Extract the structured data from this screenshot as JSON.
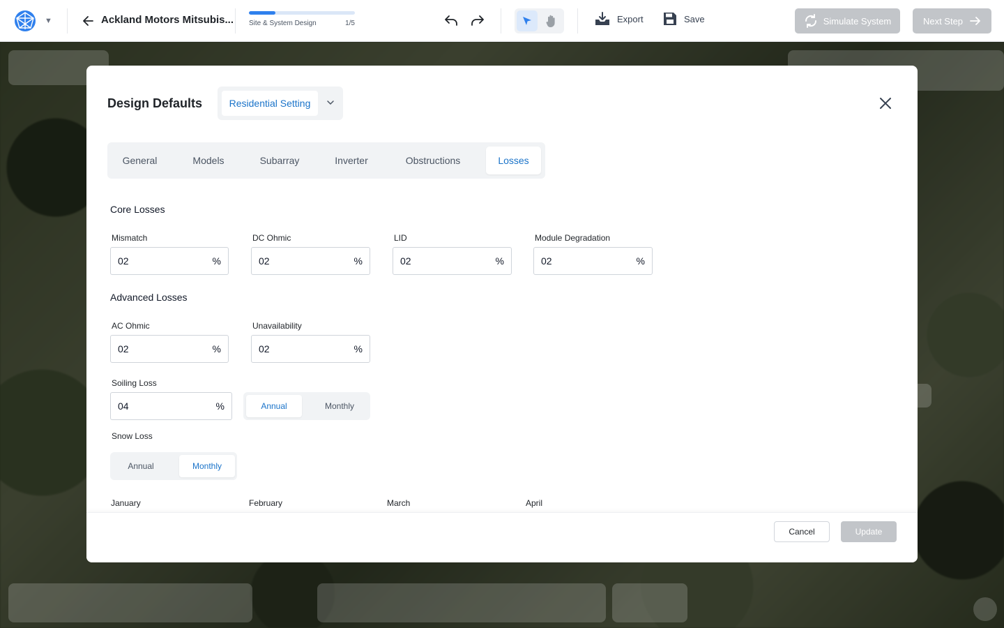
{
  "topbar": {
    "project_title": "Ackland Motors Mitsubis...",
    "progress": {
      "label": "Site & System Design",
      "step": "1/5",
      "fraction": 0.25
    },
    "export_label": "Export",
    "save_label": "Save",
    "simulate_label": "Simulate System",
    "next_label": "Next Step"
  },
  "modal": {
    "title": "Design Defaults",
    "setting": "Residential Setting",
    "tabs": [
      "General",
      "Models",
      "Subarray",
      "Inverter",
      "Obstructions",
      "Losses"
    ],
    "active_tab": "Losses",
    "core": {
      "title": "Core Losses",
      "fields": [
        {
          "label": "Mismatch",
          "value": "02",
          "unit": "%"
        },
        {
          "label": "DC Ohmic",
          "value": "02",
          "unit": "%"
        },
        {
          "label": "LID",
          "value": "02",
          "unit": "%"
        },
        {
          "label": "Module Degradation",
          "value": "02",
          "unit": "%"
        }
      ]
    },
    "advanced": {
      "title": "Advanced Losses",
      "fields": [
        {
          "label": "AC Ohmic",
          "value": "02",
          "unit": "%"
        },
        {
          "label": "Unavailability",
          "value": "02",
          "unit": "%"
        }
      ],
      "soiling": {
        "label": "Soiling Loss",
        "value": "04",
        "unit": "%",
        "options": [
          "Annual",
          "Monthly"
        ],
        "selected": "Annual"
      },
      "snow": {
        "label": "Snow Loss",
        "options": [
          "Annual",
          "Monthly"
        ],
        "selected": "Monthly"
      },
      "months": [
        "January",
        "February",
        "March",
        "April"
      ]
    },
    "footer": {
      "cancel_label": "Cancel",
      "update_label": "Update"
    }
  },
  "colors": {
    "accent": "#1a73c9",
    "progress": "#2f80ed",
    "disabled": "#c2c5c9"
  }
}
